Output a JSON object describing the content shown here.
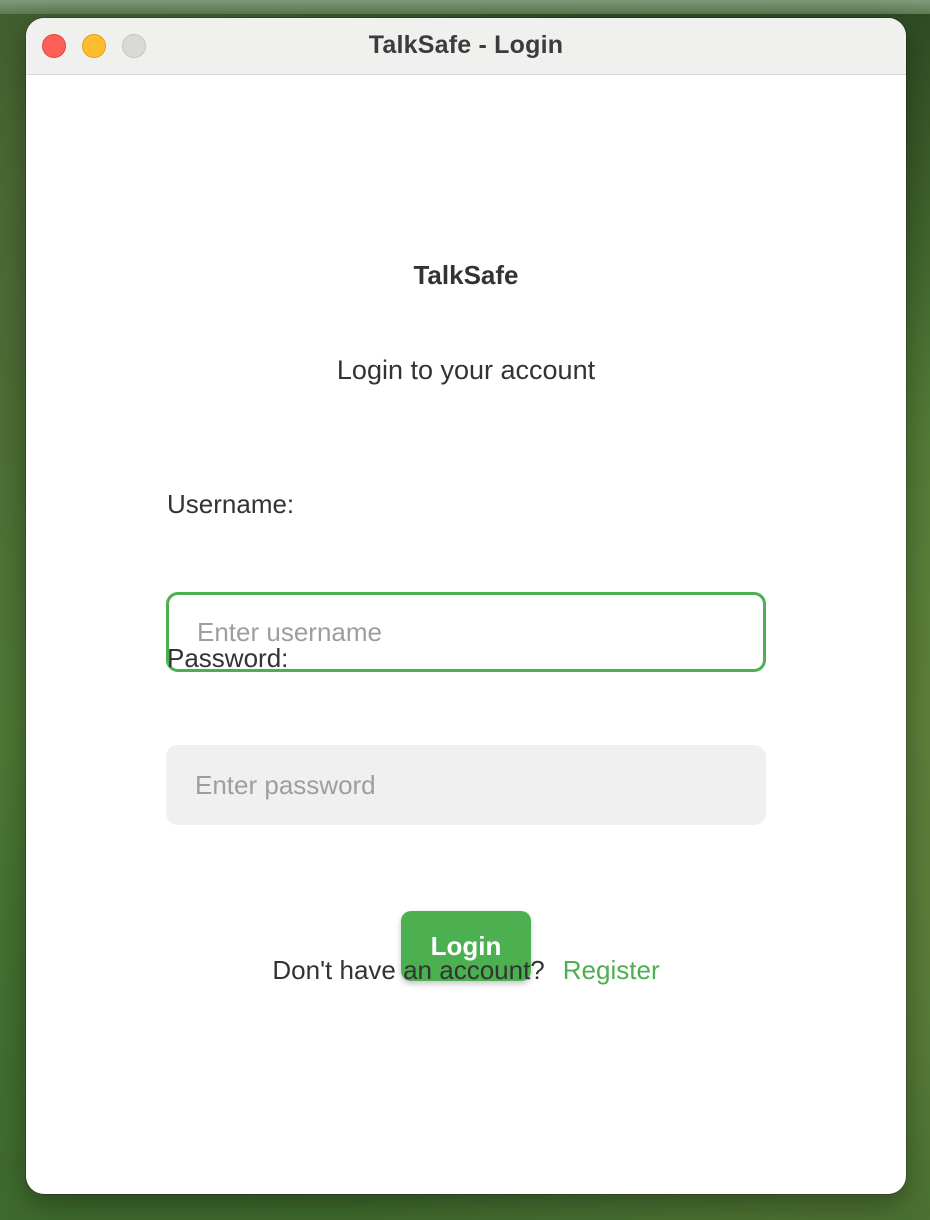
{
  "window": {
    "title": "TalkSafe - Login"
  },
  "login": {
    "app_name": "TalkSafe",
    "subtitle": "Login to your account",
    "username_label": "Username:",
    "username_placeholder": "Enter username",
    "username_value": "",
    "password_label": "Password:",
    "password_placeholder": "Enter password",
    "password_value": "",
    "login_button": "Login",
    "register_prompt": "Don't have an account?",
    "register_link": "Register"
  },
  "colors": {
    "accent": "#4caf50",
    "close": "#fe5f57",
    "minimize": "#febc2e",
    "zoom": "#d9d9d7"
  }
}
